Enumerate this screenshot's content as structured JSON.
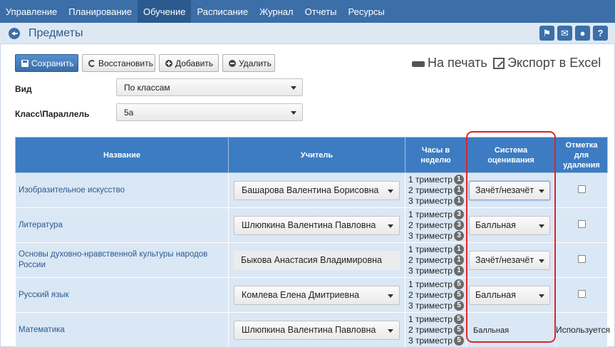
{
  "nav": {
    "items": [
      {
        "label": "Управление",
        "active": false
      },
      {
        "label": "Планирование",
        "active": false
      },
      {
        "label": "Обучение",
        "active": true
      },
      {
        "label": "Расписание",
        "active": false
      },
      {
        "label": "Журнал",
        "active": false
      },
      {
        "label": "Отчеты",
        "active": false
      },
      {
        "label": "Ресурсы",
        "active": false
      }
    ]
  },
  "titlebar": {
    "title": "Предметы",
    "icons": [
      "megaphone-icon",
      "mail-icon",
      "chat-icon",
      "help-icon"
    ],
    "help_glyph": "?"
  },
  "toolbar": {
    "save_label": "Сохранить",
    "restore_label": "Восстановить",
    "add_label": "Добавить",
    "delete_label": "Удалить",
    "print_label": "На печать",
    "export_label": "Экспорт в Excel"
  },
  "filters": {
    "view_label": "Вид",
    "view_value": "По классам",
    "class_label": "Класс\\Параллель",
    "class_value": "5а"
  },
  "table": {
    "headers": {
      "name": "Название",
      "teacher": "Учитель",
      "hours": "Часы в неделю",
      "grading": "Система оценивания",
      "delete": "Отметка для удаления"
    },
    "rows": [
      {
        "subject": "Изобразительное искусство",
        "teacher": "Башарова Валентина Борисовна",
        "teacher_select": true,
        "hours": [
          {
            "label": "1 триместр",
            "value": "1"
          },
          {
            "label": "2 триместр",
            "value": "1"
          },
          {
            "label": "3 триместр",
            "value": "1"
          }
        ],
        "grading": "Зачёт/незачёт",
        "grading_select": true,
        "grading_focus": true,
        "delete_text": ""
      },
      {
        "subject": "Литература",
        "teacher": "Шлюпкина Валентина Павловна",
        "teacher_select": true,
        "hours": [
          {
            "label": "1 триместр",
            "value": "3"
          },
          {
            "label": "2 триместр",
            "value": "3"
          },
          {
            "label": "3 триместр",
            "value": "3"
          }
        ],
        "grading": "Балльная",
        "grading_select": true,
        "grading_focus": false,
        "delete_text": ""
      },
      {
        "subject": "Основы духовно-нравственной культуры народов России",
        "teacher": "Быкова Анастасия Владимировна",
        "teacher_select": false,
        "hours": [
          {
            "label": "1 триместр",
            "value": "1"
          },
          {
            "label": "2 триместр",
            "value": "1"
          },
          {
            "label": "3 триместр",
            "value": "1"
          }
        ],
        "grading": "Зачёт/незачёт",
        "grading_select": true,
        "grading_focus": false,
        "delete_text": ""
      },
      {
        "subject": "Русский язык",
        "teacher": "Комлева Елена Дмитриевна",
        "teacher_select": true,
        "hours": [
          {
            "label": "1 триместр",
            "value": "5"
          },
          {
            "label": "2 триместр",
            "value": "5"
          },
          {
            "label": "3 триместр",
            "value": "5"
          }
        ],
        "grading": "Балльная",
        "grading_select": true,
        "grading_focus": false,
        "delete_text": ""
      },
      {
        "subject": "Математика",
        "teacher": "Шлюпкина Валентина Павловна",
        "teacher_select": true,
        "hours": [
          {
            "label": "1 триместр",
            "value": "5"
          },
          {
            "label": "2 триместр",
            "value": "5"
          },
          {
            "label": "3 триместр",
            "value": "5"
          }
        ],
        "grading": "Балльная",
        "grading_select": false,
        "grading_focus": false,
        "delete_text": "Используется"
      }
    ]
  },
  "colors": {
    "nav_bg": "#3c6ea8",
    "header_bg": "#3d7cc2",
    "row_bg": "#dae7f5",
    "highlight": "#e0222a"
  }
}
